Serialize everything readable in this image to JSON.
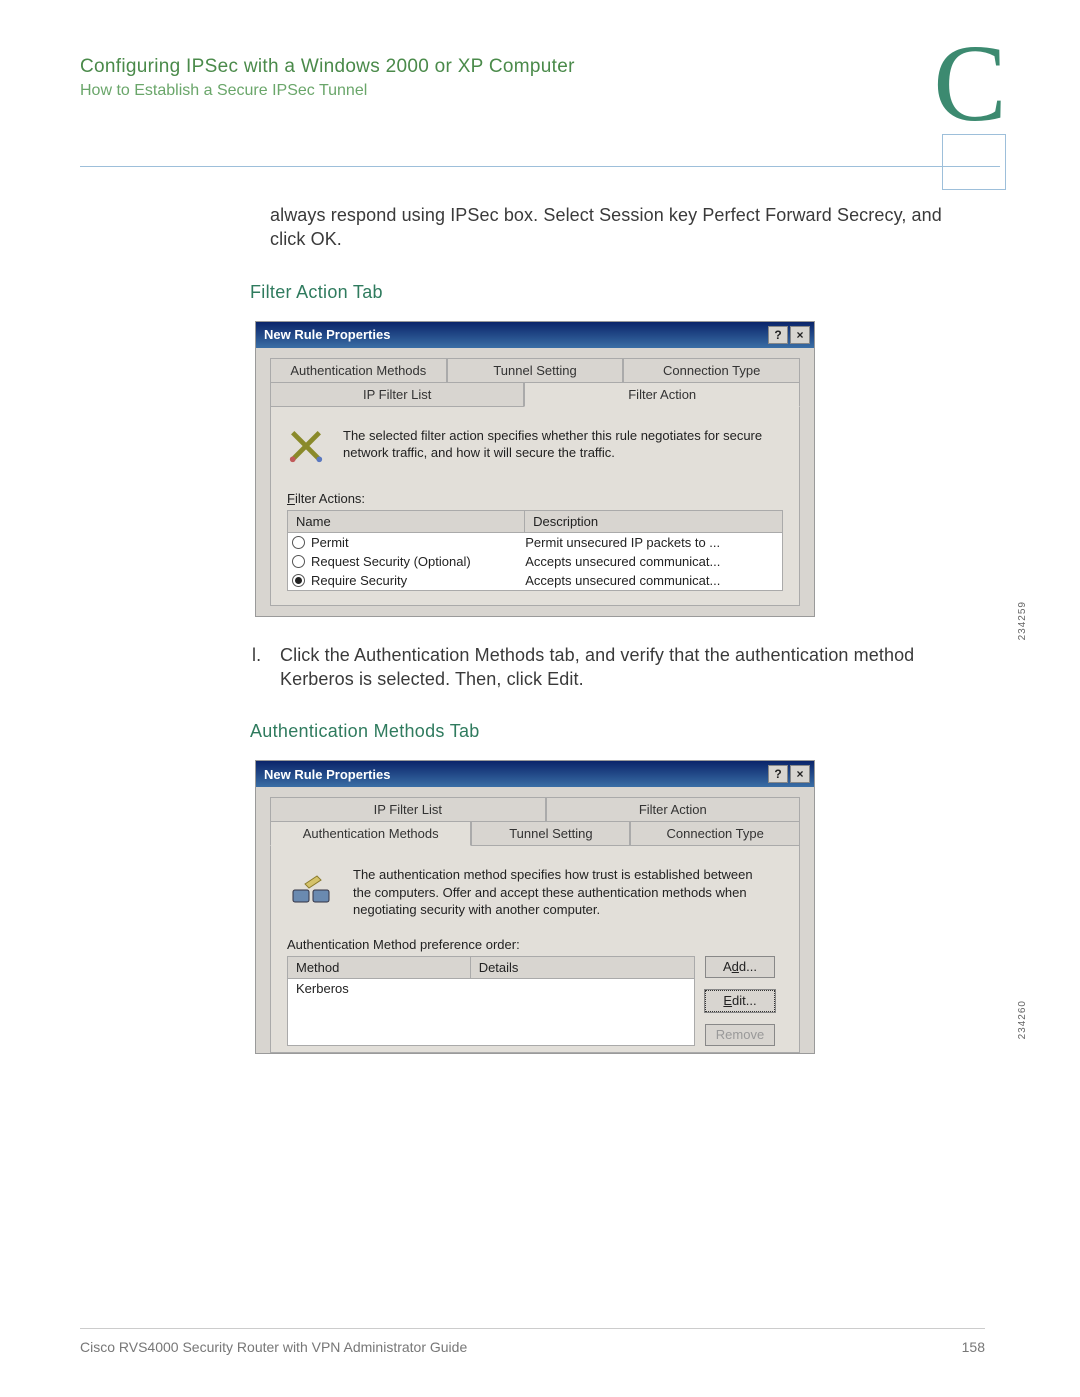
{
  "header": {
    "title": "Configuring IPSec with a Windows 2000 or XP Computer",
    "subtitle": "How to Establish a Secure IPSec Tunnel",
    "appendix_letter": "C"
  },
  "intro_text": "always respond using IPSec box. Select Session key Perfect Forward Secrecy, and click OK.",
  "section1_title": "Filter Action Tab",
  "screenshot1": {
    "window_title": "New Rule Properties",
    "tabs_back": [
      "Authentication Methods",
      "Tunnel Setting",
      "Connection Type"
    ],
    "tabs_front": [
      "IP Filter List",
      "Filter Action"
    ],
    "description": "The selected filter action specifies whether this rule negotiates for secure network traffic, and how it will secure the traffic.",
    "list_label": "Filter Actions:",
    "col_name": "Name",
    "col_desc": "Description",
    "rows": [
      {
        "name": "Permit",
        "desc": "Permit unsecured IP packets to ...",
        "checked": false
      },
      {
        "name": "Request Security (Optional)",
        "desc": "Accepts unsecured communicat...",
        "checked": false
      },
      {
        "name": "Require Security",
        "desc": "Accepts unsecured communicat...",
        "checked": true
      }
    ],
    "figure_id": "234259"
  },
  "step_l": {
    "marker": "l.",
    "text": "Click the Authentication Methods tab, and verify that the authentication method Kerberos is selected. Then, click Edit."
  },
  "section2_title": "Authentication Methods Tab",
  "screenshot2": {
    "window_title": "New Rule Properties",
    "tabs_back": [
      "IP Filter List",
      "Filter Action"
    ],
    "tabs_front": [
      "Authentication Methods",
      "Tunnel Setting",
      "Connection Type"
    ],
    "description": "The authentication method specifies how trust is established between the computers. Offer and accept these authentication methods when negotiating security with another computer.",
    "list_label": "Authentication Method preference order:",
    "col_method": "Method",
    "col_details": "Details",
    "row_method": "Kerberos",
    "btn_add": "Add...",
    "btn_edit": "Edit...",
    "btn_remove": "Remove",
    "figure_id": "234260"
  },
  "footer": {
    "left": "Cisco RVS4000 Security Router with VPN Administrator Guide",
    "page": "158"
  }
}
